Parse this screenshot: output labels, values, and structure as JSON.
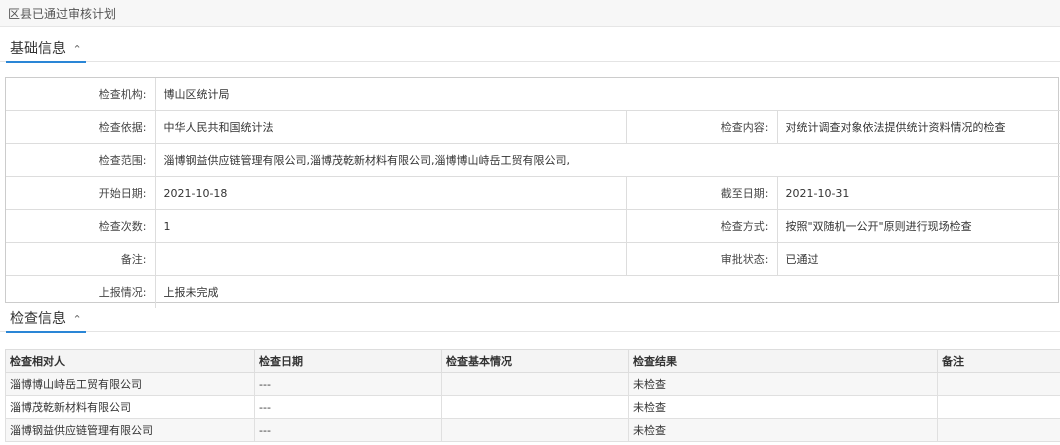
{
  "page": {
    "title": "区县已通过审核计划"
  },
  "basic_section": {
    "title": "基础信息",
    "collapse_icon": "double-chevron-up-icon",
    "rows": [
      {
        "label1": "检查机构:",
        "value1": "博山区统计局",
        "label2": "",
        "value2": ""
      },
      {
        "label1": "检查依据:",
        "value1": "中华人民共和国统计法",
        "label2": "检查内容:",
        "value2": "对统计调查对象依法提供统计资料情况的检查"
      },
      {
        "label1": "检查范围:",
        "value1": "淄博钢益供应链管理有限公司,淄博茂乾新材料有限公司,淄博博山峙岳工贸有限公司,",
        "label2": "",
        "value2": ""
      },
      {
        "label1": "开始日期:",
        "value1": "2021-10-18",
        "label2": "截至日期:",
        "value2": "2021-10-31"
      },
      {
        "label1": "检查次数:",
        "value1": "1",
        "label2": "检查方式:",
        "value2": "按照\"双随机一公开\"原则进行现场检查"
      },
      {
        "label1": "备注:",
        "value1": "",
        "label2": "审批状态:",
        "value2": "已通过"
      },
      {
        "label1": "上报情况:",
        "value1": "上报未完成",
        "label2": "",
        "value2": ""
      }
    ]
  },
  "check_section": {
    "title": "检查信息",
    "collapse_icon": "double-chevron-up-icon",
    "columns": [
      "检查相对人",
      "检查日期",
      "检查基本情况",
      "检查结果",
      "备注"
    ],
    "rows": [
      [
        "淄博博山峙岳工贸有限公司",
        "---",
        "",
        "未检查",
        ""
      ],
      [
        "淄博茂乾新材料有限公司",
        "---",
        "",
        "未检查",
        ""
      ],
      [
        "淄博钢益供应链管理有限公司",
        "---",
        "",
        "未检查",
        ""
      ]
    ]
  }
}
